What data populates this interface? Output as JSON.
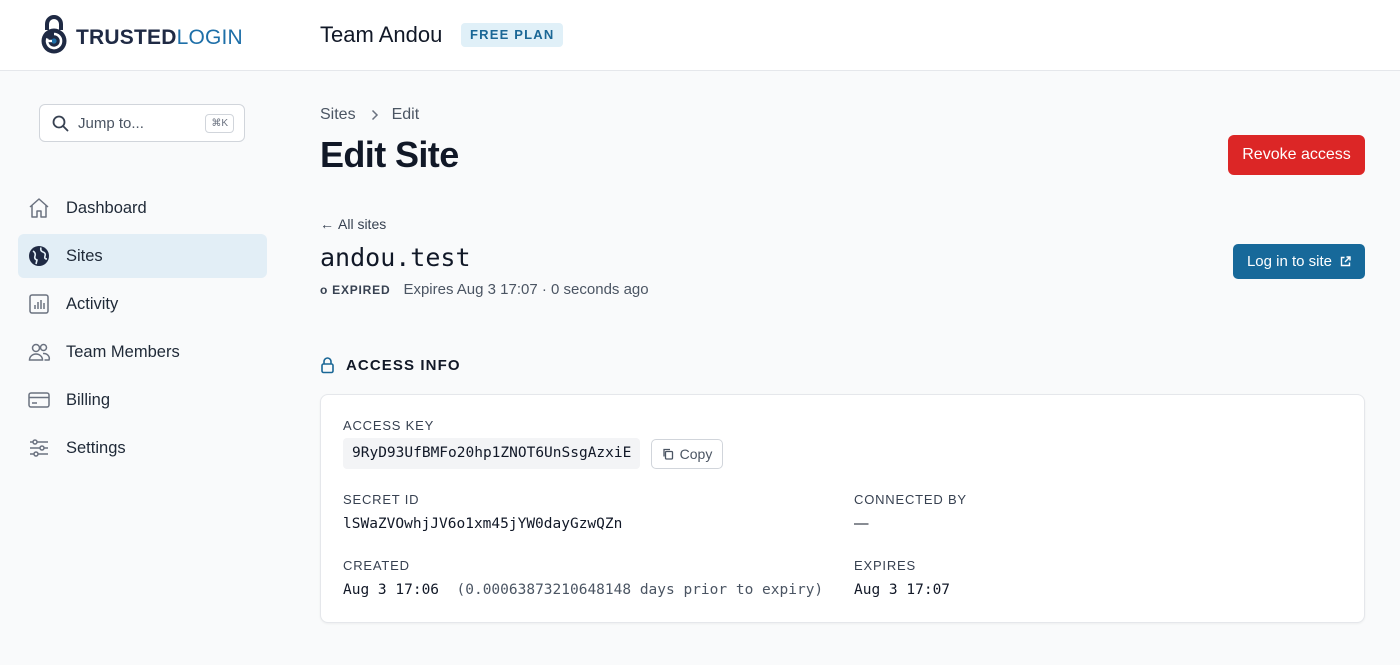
{
  "brand": {
    "logo_bold": "TRUSTED",
    "logo_light": "LOGIN",
    "icon": "lock-logo-icon",
    "color_dark": "#1f2a44",
    "color_accent": "#1e6fa8"
  },
  "header": {
    "team_name": "Team Andou",
    "plan_badge": "FREE PLAN"
  },
  "sidebar": {
    "search": {
      "label": "Jump to...",
      "shortcut": "⌘K",
      "icon": "search-icon"
    },
    "items": [
      {
        "label": "Dashboard",
        "icon": "home-icon",
        "active": false
      },
      {
        "label": "Sites",
        "icon": "globe-icon",
        "active": true
      },
      {
        "label": "Activity",
        "icon": "chart-icon",
        "active": false
      },
      {
        "label": "Team Members",
        "icon": "users-icon",
        "active": false
      },
      {
        "label": "Billing",
        "icon": "credit-card-icon",
        "active": false
      },
      {
        "label": "Settings",
        "icon": "sliders-icon",
        "active": false
      }
    ]
  },
  "breadcrumb": {
    "parent": "Sites",
    "current": "Edit"
  },
  "page": {
    "title": "Edit Site",
    "revoke_label": "Revoke access",
    "back_label": "All sites",
    "site_name": "andou.test",
    "status_badge": "EXPIRED",
    "status_text": "Expires Aug 3 17:07 · 0 seconds ago",
    "login_label": "Log in to site"
  },
  "access_info": {
    "title": "ACCESS INFO",
    "access_key_label": "ACCESS KEY",
    "access_key": "9RyD93UfBMFo20hp1ZNOT6UnSsgAzxiE",
    "copy_label": "Copy",
    "secret_id_label": "SECRET ID",
    "secret_id": "lSWaZVOwhjJV6o1xm45jYW0dayGzwQZn",
    "connected_by_label": "CONNECTED BY",
    "connected_by": "—",
    "created_label": "CREATED",
    "created": "Aug 3 17:06",
    "created_note": "(0.00063873210648148 days prior to expiry)",
    "expires_label": "EXPIRES",
    "expires": "Aug 3 17:07"
  },
  "colors": {
    "danger": "#dc2626",
    "primary": "#17699a",
    "active_nav_bg": "#e2eef6",
    "badge_bg": "#e0f0f8"
  }
}
